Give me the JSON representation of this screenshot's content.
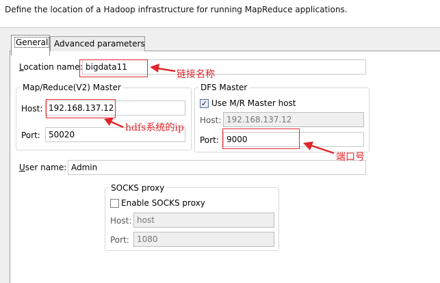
{
  "header": {
    "description": "Define the location of a Hadoop infrastructure for running MapReduce applications."
  },
  "tabs": [
    {
      "label": "General"
    },
    {
      "label": "Advanced parameters"
    }
  ],
  "location": {
    "label": "Location name:",
    "value": "bigdata11"
  },
  "mapreduce": {
    "title": "Map/Reduce(V2) Master",
    "host_label": "Host:",
    "host_value": "192.168.137.12",
    "port_label": "Port:",
    "port_value": "50020"
  },
  "dfs": {
    "title": "DFS Master",
    "use_mr_label": "Use M/R Master host",
    "use_mr_checked": true,
    "host_label": "Host:",
    "host_value": "192.168.137.12",
    "port_label": "Port:",
    "port_value": "9000"
  },
  "user": {
    "label": "User name:",
    "value": "Admin"
  },
  "socks": {
    "title": "SOCKS proxy",
    "enable_label": "Enable SOCKS proxy",
    "enable_checked": false,
    "host_label": "Host:",
    "host_placeholder": "host",
    "port_label": "Port:",
    "port_value": "1080"
  },
  "annotations": {
    "location": "链接名称",
    "host": "hdfs系统的ip",
    "port": "端口号",
    "color": "#e0262b"
  }
}
